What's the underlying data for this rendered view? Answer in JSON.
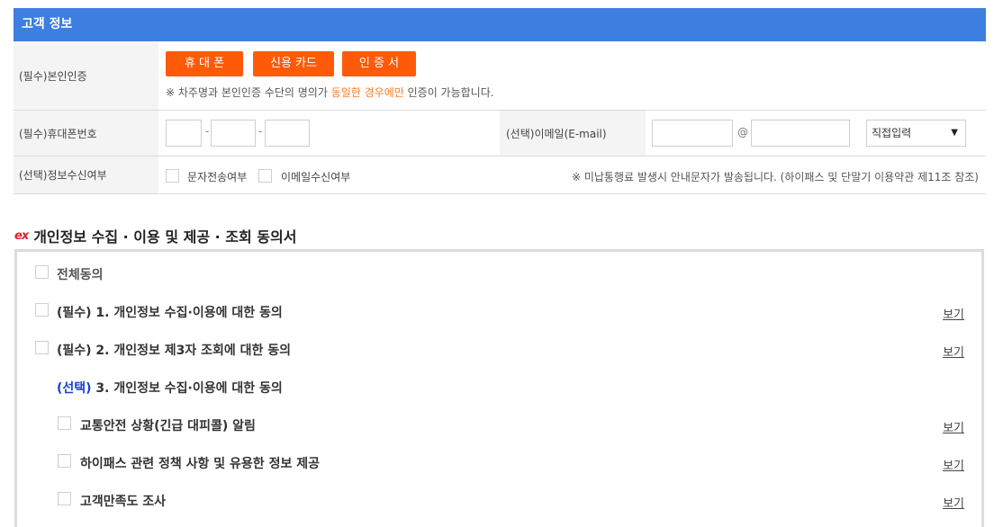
{
  "section_title": "고객 정보",
  "identity": {
    "label": "(필수)본인인증",
    "buttons": [
      "휴 대 폰",
      "신용 카드",
      "인 증 서"
    ],
    "notice_prefix": "※ 차주명과 본인인증 수단의 명의가 ",
    "notice_highlight": "동일한 경우에만",
    "notice_suffix": " 인증이 가능합니다."
  },
  "phone": {
    "label": "(필수)휴대폰번호",
    "part1": "",
    "part2": "",
    "part3": "",
    "separator": "-"
  },
  "email": {
    "label": "(선택)이메일(E-mail)",
    "local": "",
    "domain": "",
    "at": "@",
    "select_value": "직접입력"
  },
  "receive": {
    "label": "(선택)정보수신여부",
    "sms": "문자전송여부",
    "mail": "이메일수신여부",
    "notice": "※ 미납통행료 발생시 안내문자가 발송됩니다. (하이패스 및 단말기 이용약관 제11조 참조)"
  },
  "consent": {
    "logo": "ex",
    "title": "개인정보 수집 · 이용 및 제공 · 조회 동의서",
    "all": "전체동의",
    "view_label": "보기",
    "item1": "(필수) 1. 개인정보 수집·이용에 대한 동의",
    "item2": "(필수) 2. 개인정보 제3자 조회에 대한 동의",
    "item3_tag": "(선택)",
    "item3_text": " 3. 개인정보 수집·이용에 대한 동의",
    "sub1": "교통안전 상황(긴급 대피콜) 알림",
    "sub2": "하이패스 관련 정책 사항 및 유용한 정보 제공",
    "sub3": "고객만족도 조사"
  },
  "colors": {
    "header_blue": "#3d7fe0",
    "button_orange": "#ff5a0a",
    "highlight_orange": "#ff7a1a",
    "select_blue": "#1a40d0"
  }
}
